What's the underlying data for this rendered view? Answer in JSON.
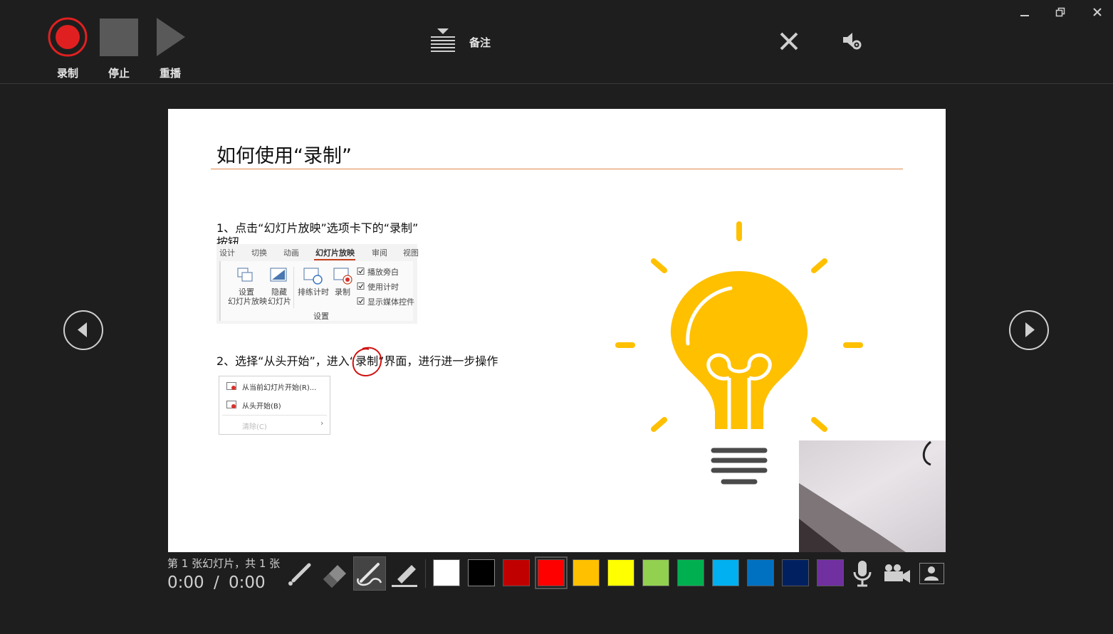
{
  "toolbar": {
    "record_label": "录制",
    "stop_label": "停止",
    "replay_label": "重播",
    "notes_label": "备注"
  },
  "slide": {
    "title": "如何使用“录制”",
    "step1_line1": "1、点击“幻灯片放映”选项卡下的“录制”",
    "step1_line2": "按钮",
    "step2_a": "2、选择“从头开始”，进入“",
    "step2_b": "录制",
    "step2_c": "”界面，进行进一步操作",
    "ribbon": {
      "tabs": [
        "设计",
        "切换",
        "动画",
        "幻灯片放映",
        "审阅",
        "视图"
      ],
      "setup_slideshow": [
        "设置",
        "幻灯片放映"
      ],
      "hide_slide": [
        "隐藏",
        "幻灯片"
      ],
      "rehearse": "排练计时",
      "record": "录制",
      "checkboxes": [
        "播放旁白",
        "使用计时",
        "显示媒体控件"
      ],
      "group": "设置"
    },
    "menu": {
      "item1": "从当前幻灯片开始(R)...",
      "item2": "从头开始(B)",
      "item3": "清除(C)"
    }
  },
  "status": {
    "slide_counter": "第 1 张幻灯片，共 1 张",
    "time_elapsed": "0:00",
    "time_separator": "/",
    "time_total": "0:00"
  },
  "colors": {
    "swatches": [
      "#ffffff",
      "#000000",
      "#c00000",
      "#ff0000",
      "#ffc000",
      "#ffff00",
      "#92d050",
      "#00b050",
      "#00b0f0",
      "#0070c0",
      "#002060",
      "#7030a0"
    ],
    "selected_swatch": "#ff0000",
    "record_accent": "#e02020",
    "bulb": "#ffc000",
    "bulb_base": "#4a4a4a",
    "title_rule": "#e0894b"
  }
}
